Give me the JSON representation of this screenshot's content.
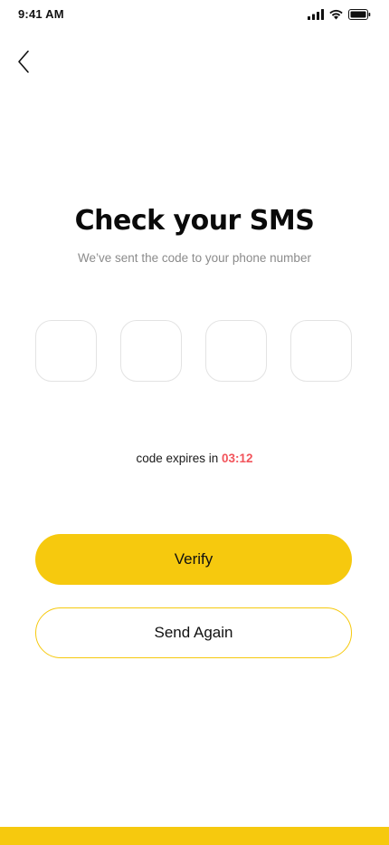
{
  "status_bar": {
    "time": "9:41 AM",
    "icons": [
      "signal-icon",
      "wifi-icon",
      "battery-icon"
    ]
  },
  "header": {
    "back_icon": "chevron-left-icon"
  },
  "main": {
    "title": "Check your SMS",
    "subtitle": "We’ve sent the code to your phone number",
    "otp": {
      "digits": [
        "",
        "",
        "",
        ""
      ]
    },
    "expiry": {
      "label": "code expires in",
      "timer": "03:12"
    },
    "buttons": {
      "verify_label": "Verify",
      "send_again_label": "Send Again"
    }
  },
  "colors": {
    "accent": "#f6c90e",
    "timer": "#f2545b",
    "subtitle": "#8b8b8b",
    "input_border": "#e3e3e3"
  }
}
